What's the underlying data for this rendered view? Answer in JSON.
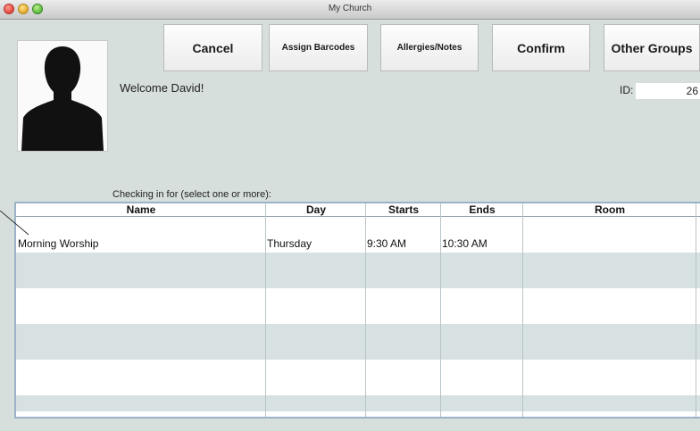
{
  "window": {
    "title": "My Church"
  },
  "toolbar": {
    "cancel": "Cancel",
    "assign_barcodes": "Assign Barcodes",
    "allergies_notes": "Allergies/Notes",
    "confirm": "Confirm",
    "other_groups": "Other Groups"
  },
  "welcome": "Welcome David!",
  "id": {
    "label": "ID:",
    "value": "26"
  },
  "list_label": "Checking in for (select one or more):",
  "table": {
    "columns": [
      "Name",
      "Day",
      "Starts",
      "Ends",
      "Room"
    ],
    "rows": [
      {
        "name": "Morning Worship",
        "day": "Thursday",
        "starts": "9:30 AM",
        "ends": "10:30 AM",
        "room": ""
      }
    ]
  }
}
